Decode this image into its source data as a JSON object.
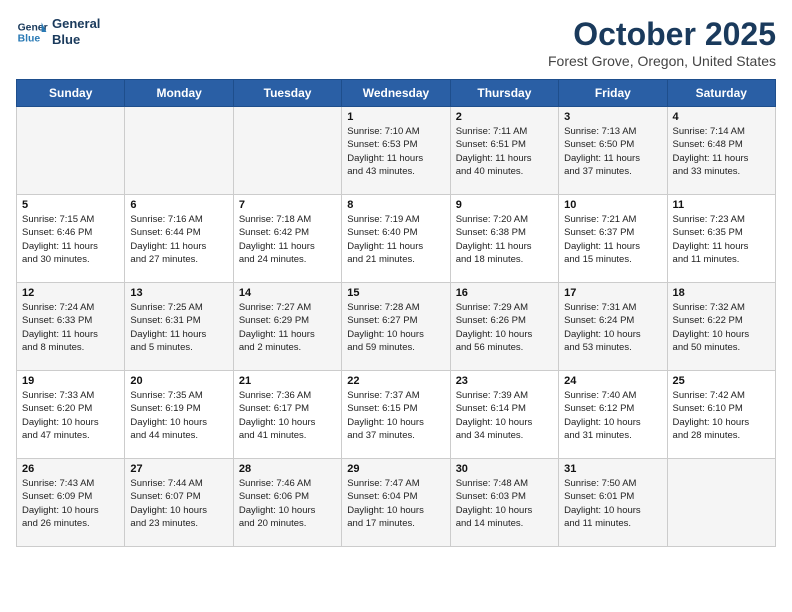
{
  "header": {
    "logo_line1": "General",
    "logo_line2": "Blue",
    "month": "October 2025",
    "location": "Forest Grove, Oregon, United States"
  },
  "days_of_week": [
    "Sunday",
    "Monday",
    "Tuesday",
    "Wednesday",
    "Thursday",
    "Friday",
    "Saturday"
  ],
  "weeks": [
    [
      {
        "day": "",
        "info": ""
      },
      {
        "day": "",
        "info": ""
      },
      {
        "day": "",
        "info": ""
      },
      {
        "day": "1",
        "info": "Sunrise: 7:10 AM\nSunset: 6:53 PM\nDaylight: 11 hours\nand 43 minutes."
      },
      {
        "day": "2",
        "info": "Sunrise: 7:11 AM\nSunset: 6:51 PM\nDaylight: 11 hours\nand 40 minutes."
      },
      {
        "day": "3",
        "info": "Sunrise: 7:13 AM\nSunset: 6:50 PM\nDaylight: 11 hours\nand 37 minutes."
      },
      {
        "day": "4",
        "info": "Sunrise: 7:14 AM\nSunset: 6:48 PM\nDaylight: 11 hours\nand 33 minutes."
      }
    ],
    [
      {
        "day": "5",
        "info": "Sunrise: 7:15 AM\nSunset: 6:46 PM\nDaylight: 11 hours\nand 30 minutes."
      },
      {
        "day": "6",
        "info": "Sunrise: 7:16 AM\nSunset: 6:44 PM\nDaylight: 11 hours\nand 27 minutes."
      },
      {
        "day": "7",
        "info": "Sunrise: 7:18 AM\nSunset: 6:42 PM\nDaylight: 11 hours\nand 24 minutes."
      },
      {
        "day": "8",
        "info": "Sunrise: 7:19 AM\nSunset: 6:40 PM\nDaylight: 11 hours\nand 21 minutes."
      },
      {
        "day": "9",
        "info": "Sunrise: 7:20 AM\nSunset: 6:38 PM\nDaylight: 11 hours\nand 18 minutes."
      },
      {
        "day": "10",
        "info": "Sunrise: 7:21 AM\nSunset: 6:37 PM\nDaylight: 11 hours\nand 15 minutes."
      },
      {
        "day": "11",
        "info": "Sunrise: 7:23 AM\nSunset: 6:35 PM\nDaylight: 11 hours\nand 11 minutes."
      }
    ],
    [
      {
        "day": "12",
        "info": "Sunrise: 7:24 AM\nSunset: 6:33 PM\nDaylight: 11 hours\nand 8 minutes."
      },
      {
        "day": "13",
        "info": "Sunrise: 7:25 AM\nSunset: 6:31 PM\nDaylight: 11 hours\nand 5 minutes."
      },
      {
        "day": "14",
        "info": "Sunrise: 7:27 AM\nSunset: 6:29 PM\nDaylight: 11 hours\nand 2 minutes."
      },
      {
        "day": "15",
        "info": "Sunrise: 7:28 AM\nSunset: 6:27 PM\nDaylight: 10 hours\nand 59 minutes."
      },
      {
        "day": "16",
        "info": "Sunrise: 7:29 AM\nSunset: 6:26 PM\nDaylight: 10 hours\nand 56 minutes."
      },
      {
        "day": "17",
        "info": "Sunrise: 7:31 AM\nSunset: 6:24 PM\nDaylight: 10 hours\nand 53 minutes."
      },
      {
        "day": "18",
        "info": "Sunrise: 7:32 AM\nSunset: 6:22 PM\nDaylight: 10 hours\nand 50 minutes."
      }
    ],
    [
      {
        "day": "19",
        "info": "Sunrise: 7:33 AM\nSunset: 6:20 PM\nDaylight: 10 hours\nand 47 minutes."
      },
      {
        "day": "20",
        "info": "Sunrise: 7:35 AM\nSunset: 6:19 PM\nDaylight: 10 hours\nand 44 minutes."
      },
      {
        "day": "21",
        "info": "Sunrise: 7:36 AM\nSunset: 6:17 PM\nDaylight: 10 hours\nand 41 minutes."
      },
      {
        "day": "22",
        "info": "Sunrise: 7:37 AM\nSunset: 6:15 PM\nDaylight: 10 hours\nand 37 minutes."
      },
      {
        "day": "23",
        "info": "Sunrise: 7:39 AM\nSunset: 6:14 PM\nDaylight: 10 hours\nand 34 minutes."
      },
      {
        "day": "24",
        "info": "Sunrise: 7:40 AM\nSunset: 6:12 PM\nDaylight: 10 hours\nand 31 minutes."
      },
      {
        "day": "25",
        "info": "Sunrise: 7:42 AM\nSunset: 6:10 PM\nDaylight: 10 hours\nand 28 minutes."
      }
    ],
    [
      {
        "day": "26",
        "info": "Sunrise: 7:43 AM\nSunset: 6:09 PM\nDaylight: 10 hours\nand 26 minutes."
      },
      {
        "day": "27",
        "info": "Sunrise: 7:44 AM\nSunset: 6:07 PM\nDaylight: 10 hours\nand 23 minutes."
      },
      {
        "day": "28",
        "info": "Sunrise: 7:46 AM\nSunset: 6:06 PM\nDaylight: 10 hours\nand 20 minutes."
      },
      {
        "day": "29",
        "info": "Sunrise: 7:47 AM\nSunset: 6:04 PM\nDaylight: 10 hours\nand 17 minutes."
      },
      {
        "day": "30",
        "info": "Sunrise: 7:48 AM\nSunset: 6:03 PM\nDaylight: 10 hours\nand 14 minutes."
      },
      {
        "day": "31",
        "info": "Sunrise: 7:50 AM\nSunset: 6:01 PM\nDaylight: 10 hours\nand 11 minutes."
      },
      {
        "day": "",
        "info": ""
      }
    ]
  ]
}
